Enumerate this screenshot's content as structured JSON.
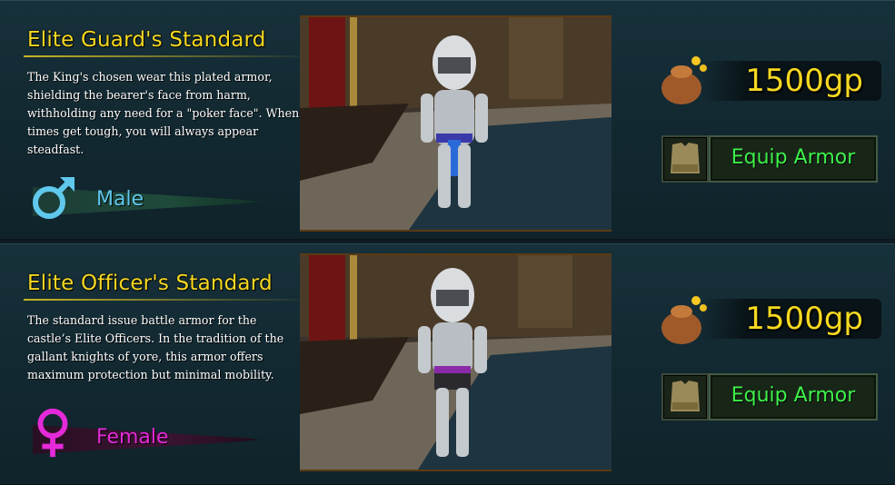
{
  "items": [
    {
      "title": "Elite Guard's Standard",
      "description": "The King's chosen wear this plated armor, shielding the bearer's face from harm, withholding any need for a \"poker face\". When times get tough, you will always appear steadfast.",
      "gender_label": "Male",
      "gender_color": "#5fc8ec",
      "price": "1500gp",
      "equip_label": "Equip Armor",
      "belt_color": "#3a3aa8"
    },
    {
      "title": "Elite Officer's Standard",
      "description": "The standard issue battle armor for the castle’s Elite Officers. In the tradition of the gallant knights of yore, this armor offers maximum protection but minimal mobility.",
      "gender_label": "Female",
      "gender_color": "#e42ad8",
      "price": "1500gp",
      "equip_label": "Equip Armor",
      "belt_color": "#8a2aa8"
    }
  ],
  "colors": {
    "title": "#f6d820",
    "price": "#f6d820",
    "equip_text": "#3ef04a"
  }
}
